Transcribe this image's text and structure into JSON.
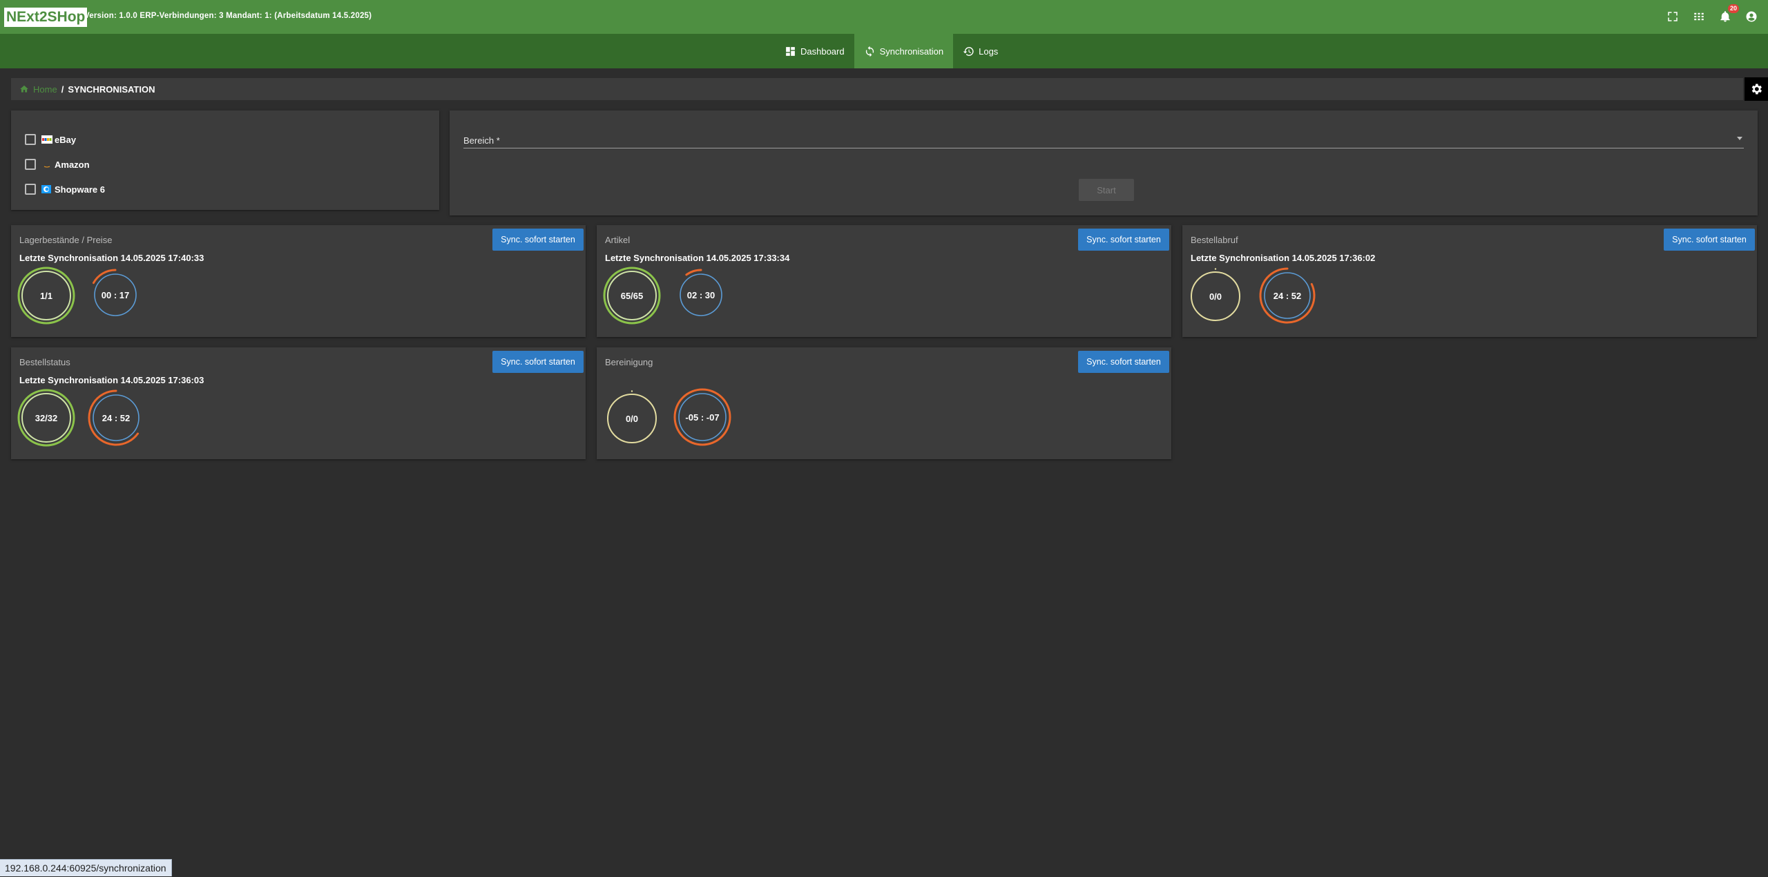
{
  "header": {
    "logo": "NExt2SHop",
    "version_text": "Version: 1.0.0 ERP-Verbindungen: 3 Mandant: 1: (Arbeitsdatum 14.5.2025)",
    "notification_count": "20",
    "icons": [
      "fullscreen-icon",
      "apps-grid-icon",
      "bell-icon",
      "account-icon"
    ],
    "brand_color": "#4e8f41"
  },
  "nav": {
    "items": [
      {
        "label": "Dashboard",
        "icon": "dashboard-icon"
      },
      {
        "label": "Synchronisation",
        "icon": "sync-icon",
        "active": true
      },
      {
        "label": "Logs",
        "icon": "history-icon"
      }
    ]
  },
  "breadcrumb": {
    "home": "Home",
    "separator": "/",
    "current": "SYNCHRONISATION"
  },
  "shops": {
    "items": [
      {
        "label": "eBay",
        "checked": false
      },
      {
        "label": "Amazon",
        "checked": false
      },
      {
        "label": "Shopware 6",
        "checked": false
      }
    ]
  },
  "bereich": {
    "label": "Bereich *",
    "value": "",
    "start_label": "Start"
  },
  "sync_button_label": "Sync. sofort starten",
  "cards": [
    {
      "title": "Lagerbestände / Preise",
      "last_sync": "Letzte Synchronisation 14.05.2025 17:40:33",
      "count": "1/1",
      "count_fraction": 1.0,
      "count_color": "#8bc34a",
      "timer": "00 : 17",
      "timer_fraction": 0.17,
      "timer_color": "#e9672b"
    },
    {
      "title": "Artikel",
      "last_sync": "Letzte Synchronisation 14.05.2025 17:33:34",
      "count": "65/65",
      "count_fraction": 1.0,
      "count_color": "#8bc34a",
      "timer": "02 : 30",
      "timer_fraction": 0.1,
      "timer_color": "#e9672b"
    },
    {
      "title": "Bestellabruf",
      "last_sync": "Letzte Synchronisation 14.05.2025 17:36:02",
      "count": "0/0",
      "count_fraction": 0.0,
      "count_color": "#e3dca0",
      "timer": "24 : 52",
      "timer_fraction": 0.82,
      "timer_color": "#e9672b"
    },
    {
      "title": "Bestellstatus",
      "last_sync": "Letzte Synchronisation 14.05.2025 17:36:03",
      "count": "32/32",
      "count_fraction": 1.0,
      "count_color": "#8bc34a",
      "timer": "24 : 52",
      "timer_fraction": 0.65,
      "timer_color": "#e9672b"
    },
    {
      "title": "Bereinigung",
      "last_sync": "",
      "count": "0/0",
      "count_fraction": 0.0,
      "count_color": "#e3dca0",
      "timer": "-05 : -07",
      "timer_fraction": 1.0,
      "timer_color": "#e9672b"
    }
  ],
  "status_url": "192.168.0.244:60925/synchronization"
}
